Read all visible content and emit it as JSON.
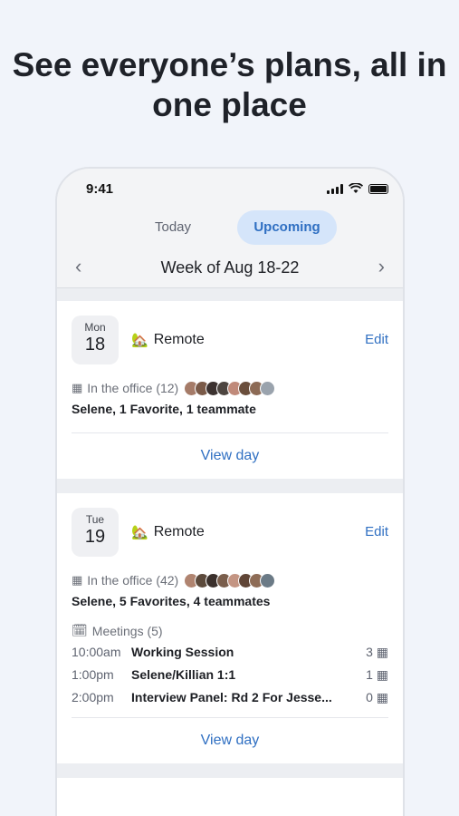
{
  "headline": "See everyone’s plans, all in one place",
  "status_bar": {
    "time": "9:41"
  },
  "tabs": {
    "today": "Today",
    "upcoming": "Upcoming"
  },
  "week": {
    "title": "Week of Aug 18-22"
  },
  "days": [
    {
      "dow": "Mon",
      "date": "18",
      "status": "Remote",
      "edit": "Edit",
      "office_text": "In the office (12)",
      "people": "Selene, 1 Favorite, 1 teammate",
      "view_day": "View day",
      "avatar_colors": [
        "#a57b68",
        "#7a5a48",
        "#3c3230",
        "#4d4540",
        "#c08a7a",
        "#6a4e3c",
        "#8c6a55",
        "#9aa3ad"
      ]
    },
    {
      "dow": "Tue",
      "date": "19",
      "status": "Remote",
      "edit": "Edit",
      "office_text": "In the office (42)",
      "people": "Selene, 5 Favorites, 4 teammates",
      "meetings_header": "Meetings (5)",
      "meetings": [
        {
          "time": "10:00am",
          "title": "Working Session",
          "count": "3"
        },
        {
          "time": "1:00pm",
          "title": "Selene/Killian 1:1",
          "count": "1"
        },
        {
          "time": "2:00pm",
          "title": "Interview Panel:  Rd 2 For Jesse...",
          "count": "0"
        }
      ],
      "view_day": "View day",
      "avatar_colors": [
        "#b08470",
        "#5c4a3c",
        "#3a302c",
        "#7a5e4c",
        "#c49583",
        "#604536",
        "#8e6c56",
        "#6b7a86"
      ]
    }
  ],
  "colors": {
    "accent": "#2f6fc2",
    "tab_active_bg": "#d5e5fa",
    "background": "#f1f4fa"
  }
}
